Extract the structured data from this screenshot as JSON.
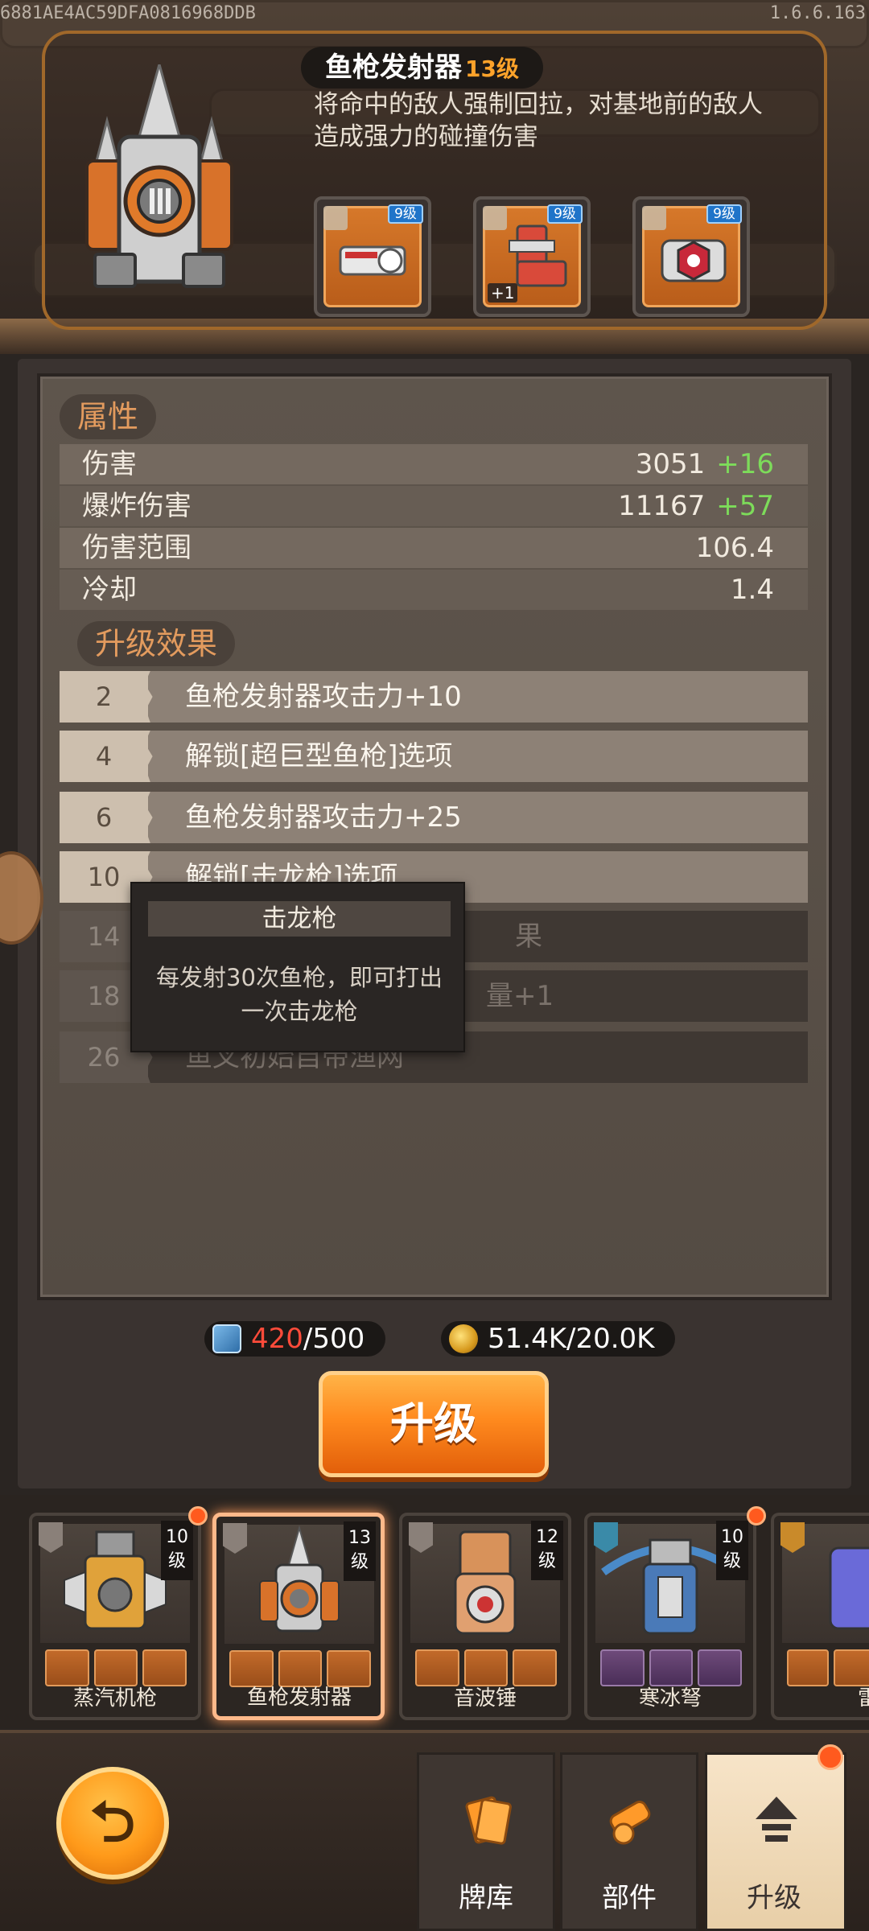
{
  "build_id": "6881AE4AC59DFA0816968DDB",
  "version": "1.6.6.163",
  "weapon": {
    "name": "鱼枪发射器",
    "level": "13级",
    "description": "将命中的敌人强制回拉，对基地前的敌人造成强力的碰撞伤害",
    "parts": [
      {
        "level": "9级",
        "extra": ""
      },
      {
        "level": "9级",
        "extra": "+1"
      },
      {
        "level": "9级",
        "extra": ""
      }
    ]
  },
  "attributes": {
    "title": "属性",
    "rows": [
      {
        "label": "伤害",
        "value": "3051",
        "bonus": "+16"
      },
      {
        "label": "爆炸伤害",
        "value": "11167",
        "bonus": "+57"
      },
      {
        "label": "伤害范围",
        "value": "106.4",
        "bonus": ""
      },
      {
        "label": "冷却",
        "value": "1.4",
        "bonus": ""
      }
    ]
  },
  "upgrades": {
    "title": "升级效果",
    "rows": [
      {
        "level": "2",
        "text": "鱼枪发射器攻击力+10",
        "unlocked": true
      },
      {
        "level": "4",
        "text": "解锁[超巨型鱼枪]选项",
        "unlocked": true
      },
      {
        "level": "6",
        "text": "鱼枪发射器攻击力+25",
        "unlocked": true
      },
      {
        "level": "10",
        "text": "解锁[击龙枪]选项",
        "unlocked": true
      },
      {
        "level": "14",
        "text": "果",
        "unlocked": false
      },
      {
        "level": "18",
        "text": "量+1",
        "unlocked": false
      },
      {
        "level": "26",
        "text": "鱼叉初始自带渔网",
        "unlocked": false
      }
    ]
  },
  "tooltip": {
    "title": "击龙枪",
    "body": "每发射30次鱼枪，即可打出一次击龙枪"
  },
  "resources": {
    "cards_current": "420",
    "cards_required": "/500",
    "gold": "51.4K/20.0K"
  },
  "upgrade_button": "升级",
  "weapons": [
    {
      "name": "蒸汽机枪",
      "level_num": "10",
      "level_unit": "级",
      "badge": true,
      "selected": false
    },
    {
      "name": "鱼枪发射器",
      "level_num": "13",
      "level_unit": "级",
      "badge": false,
      "selected": true
    },
    {
      "name": "音波锤",
      "level_num": "12",
      "level_unit": "级",
      "badge": false,
      "selected": false
    },
    {
      "name": "寒冰弩",
      "level_num": "10",
      "level_unit": "级",
      "badge": true,
      "selected": false
    },
    {
      "name": "雷",
      "level_num": "",
      "level_unit": "",
      "badge": false,
      "selected": false
    }
  ],
  "nav": {
    "tabs": [
      {
        "label": "牌库",
        "icon": "card-deck-icon"
      },
      {
        "label": "部件",
        "icon": "cannon-part-icon"
      },
      {
        "label": "升级",
        "icon": "upgrade-arrow-icon"
      }
    ],
    "active": "升级"
  },
  "colors": {
    "accent_orange": "#ff8a1e",
    "bonus_green": "#7ddc5a",
    "level_orange": "#ffa32a",
    "required_red": "#ff4b3a",
    "part_level_blue": "#1f74c9"
  }
}
